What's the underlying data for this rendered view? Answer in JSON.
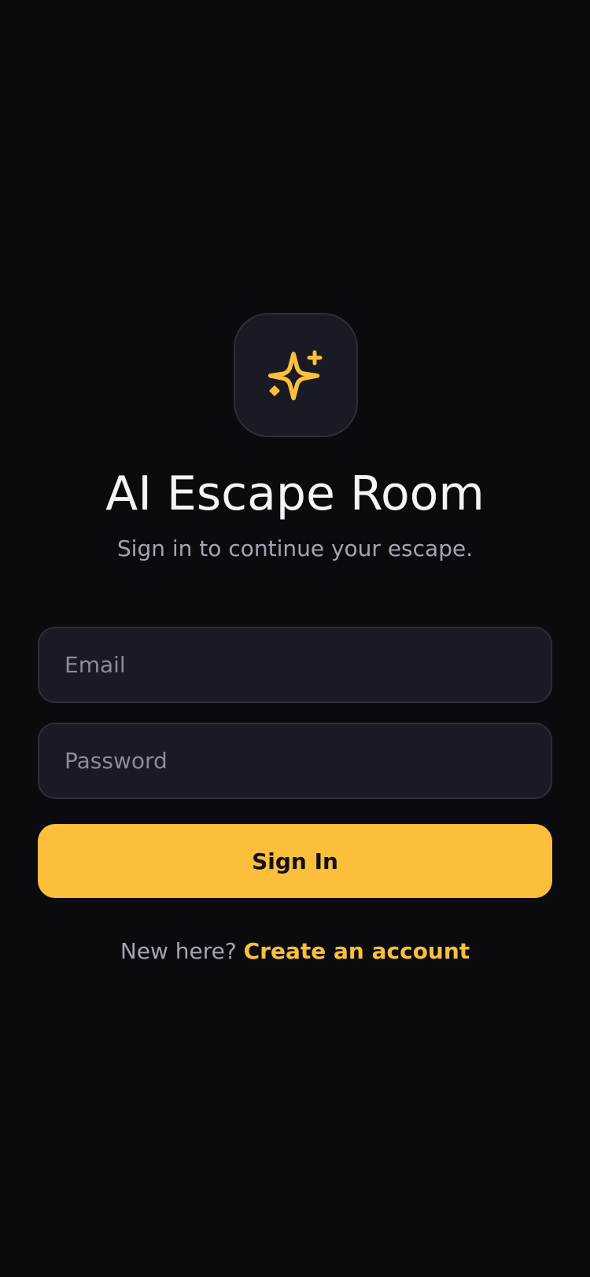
{
  "app": {
    "title": "AI Escape Room",
    "subtitle": "Sign in to continue your escape."
  },
  "logo": {
    "icon": "sparkles-icon",
    "accent_color": "#fbbf3c"
  },
  "form": {
    "email": {
      "value": "",
      "placeholder": "Email"
    },
    "password": {
      "value": "",
      "placeholder": "Password"
    },
    "submit_label": "Sign In"
  },
  "footer": {
    "prompt": "New here?",
    "link_label": "Create an account"
  },
  "colors": {
    "background": "#0b0b0f",
    "surface": "#191a23",
    "border": "#2d2e3a",
    "accent": "#fbbf3c",
    "muted_text": "#a3a3b2"
  }
}
